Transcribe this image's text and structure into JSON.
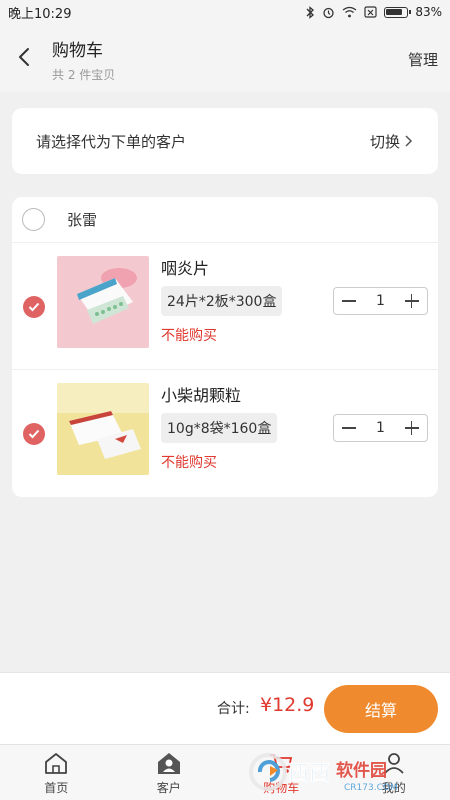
{
  "status_bar": {
    "time": "晚上10:29",
    "battery": "83%"
  },
  "header": {
    "title": "购物车",
    "subtitle": "共 2 件宝贝",
    "manage": "管理"
  },
  "customer_select": {
    "label": "请选择代为下单的客户",
    "switch": "切换"
  },
  "cart": {
    "customer_name": "张雷",
    "items": [
      {
        "name": "咽炎片",
        "spec": "24片*2板*300盒",
        "status": "不能购买",
        "qty": "1",
        "selected": true
      },
      {
        "name": "小柴胡颗粒",
        "spec": "10g*8袋*160盒",
        "status": "不能购买",
        "qty": "1",
        "selected": true
      }
    ]
  },
  "checkout": {
    "total_label": "合计:",
    "total_value": "¥12.9",
    "button": "结算"
  },
  "tabs": [
    {
      "label": "首页",
      "icon": "home-icon"
    },
    {
      "label": "客户",
      "icon": "customer-icon"
    },
    {
      "label": "购物车",
      "icon": "cart-icon",
      "active": true
    },
    {
      "label": "我的",
      "icon": "profile-icon"
    }
  ],
  "colors": {
    "accent": "#ef8a2e",
    "price": "#e0392f",
    "check": "#e06363"
  },
  "watermark": {
    "text_cn": "西西软件园",
    "text_en": "CR173.COM"
  }
}
